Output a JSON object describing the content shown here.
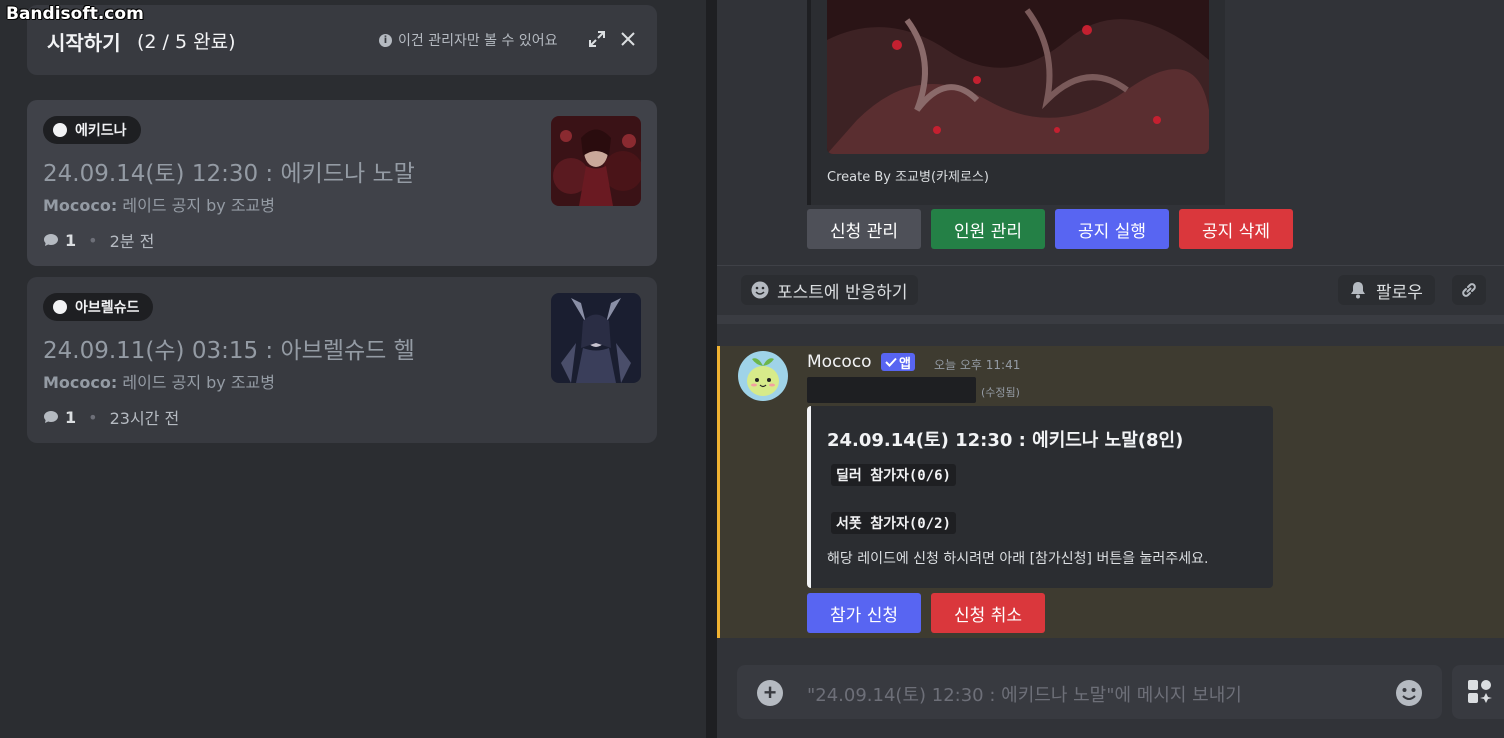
{
  "watermark": "Bandisoft.com",
  "getting_started": {
    "title": "시작하기",
    "progress": "(2 / 5 완료)",
    "info": "이건 관리자만 볼 수 있어요"
  },
  "posts": [
    {
      "tag": "에키드나",
      "title": "24.09.14(토) 12:30 : 에키드나 노말",
      "author": "Mococo:",
      "summary": " 레이드 공지 by 조교병",
      "count": "1",
      "time": "2분 전"
    },
    {
      "tag": "아브렐슈드",
      "title": "24.09.11(수) 03:15 : 아브렐슈드 헬",
      "author": "Mococo:",
      "summary": " 레이드 공지 by 조교병",
      "count": "1",
      "time": "23시간 전"
    }
  ],
  "embed_top": {
    "footer": "Create By 조교병(카제로스)"
  },
  "admin_buttons": [
    "신청 관리",
    "인원 관리",
    "공지 실행",
    "공지 삭제"
  ],
  "reaction_bar": {
    "react_label": "포스트에 반응하기",
    "follow_label": "팔로우"
  },
  "message": {
    "author": "Mococo",
    "badge": "앱",
    "time": "오늘 오후 11:41",
    "edited": "(수정됨)",
    "embed": {
      "title": "24.09.14(토) 12:30 : 에키드나 노말(8인)",
      "field1": "딜러 참가자(0/6)",
      "field2": "서폿 참가자(0/2)",
      "description": "해당 레이드에 신청 하시려면 아래 [참가신청] 버튼을 눌러주세요."
    },
    "buttons": [
      "참가 신청",
      "신청 취소"
    ]
  },
  "composer": {
    "placeholder": "\"24.09.14(토) 12:30 : 에키드나 노말\"에 메시지 보내기"
  },
  "colors": {
    "accent": "#5865f2",
    "success": "#248046",
    "danger": "#da373c",
    "highlight": "#f0b232"
  }
}
